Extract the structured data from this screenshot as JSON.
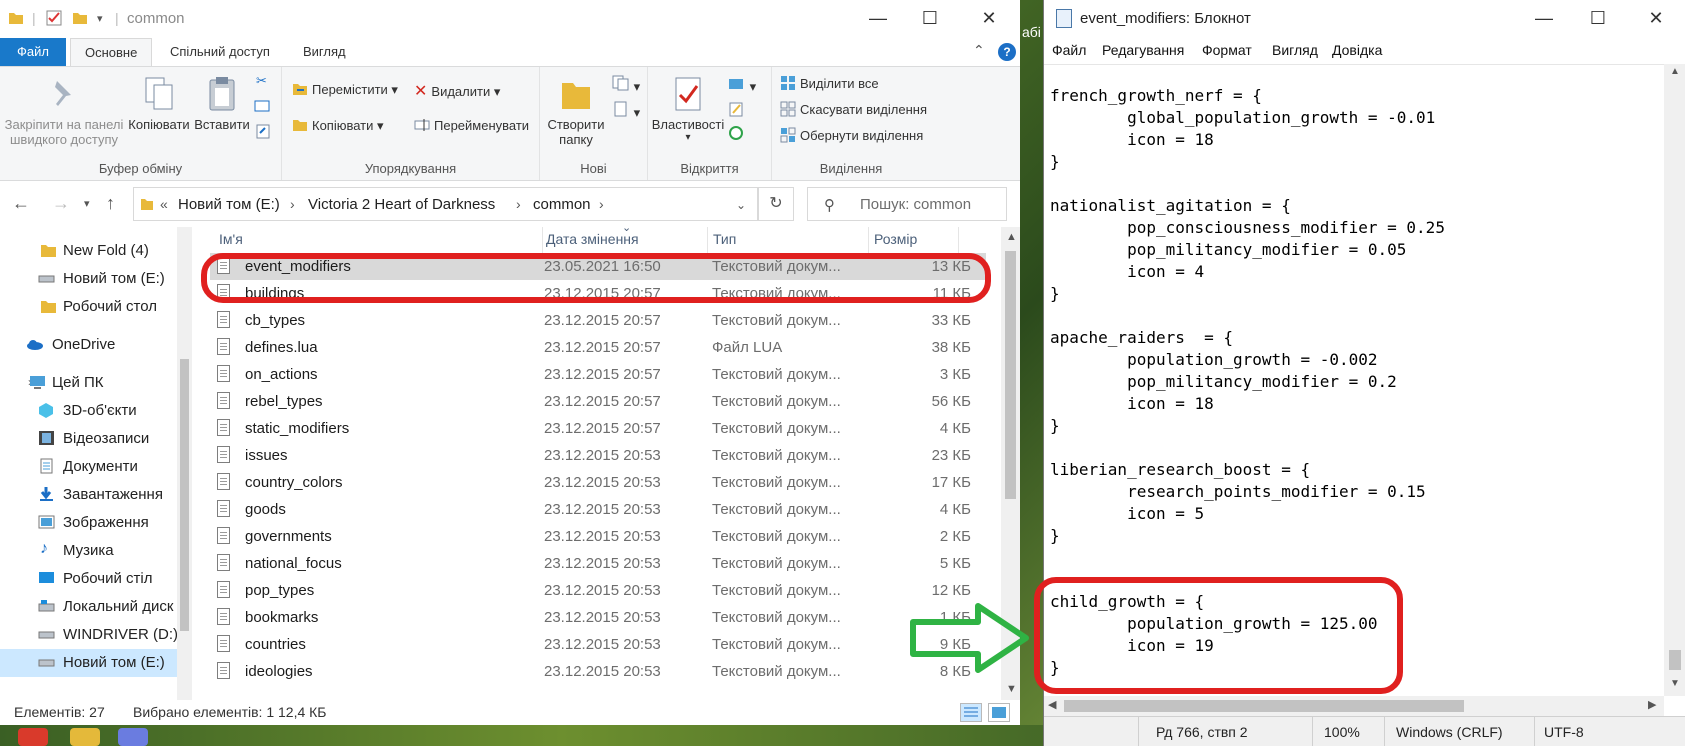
{
  "colors": {
    "accent": "#1979ca",
    "selection": "#d9d9d9",
    "highlight_red": "#e0201f",
    "arrow_green": "#2fb344"
  },
  "explorer": {
    "title": "common",
    "qa_icons": [
      "folder-icon",
      "checkbox-icon",
      "folder-icon",
      "dropdown-icon"
    ],
    "window_buttons": {
      "minimize": "—",
      "maximize": "☐",
      "close": "✕"
    },
    "tabs": {
      "file": "Файл",
      "home": "Основне",
      "share": "Спільний доступ",
      "view": "Вигляд"
    },
    "help": "?",
    "ribbon": {
      "clipboard": {
        "label": "Буфер обміну",
        "pin": "Закріпити на панелі швидкого доступу",
        "pin_line1": "Закріпити на панелі",
        "pin_line2": "швидкого доступу",
        "copy": "Копіювати",
        "paste": "Вставити"
      },
      "organize": {
        "label": "Упорядкування",
        "move": "Перемістити",
        "copy_to": "Копіювати",
        "delete": "Видалити",
        "rename": "Перейменувати"
      },
      "new": {
        "label": "Нові",
        "create_line1": "Створити",
        "create_line2": "папку"
      },
      "open": {
        "label": "Відкриття",
        "properties": "Властивості"
      },
      "select": {
        "label": "Виділення",
        "select_all": "Виділити все",
        "select_none": "Скасувати виділення",
        "invert": "Обернути виділення"
      }
    },
    "address": {
      "chevron": "«",
      "crumbs": [
        "Новий том (E:)",
        "Victoria 2 Heart of Darkness",
        "common"
      ],
      "search_placeholder": "Пошук: common"
    },
    "nav": {
      "items": [
        {
          "label": "New Fold (4)",
          "icon": "folder-icon"
        },
        {
          "label": "Новий том (E:)",
          "icon": "drive-icon"
        },
        {
          "label": "Робочий стол",
          "icon": "folder-icon"
        },
        {
          "label": "OneDrive",
          "icon": "cloud-icon"
        },
        {
          "label": "Цей ПК",
          "icon": "pc-icon"
        },
        {
          "label": "3D-об'єкти",
          "icon": "cube-icon"
        },
        {
          "label": "Відеозаписи",
          "icon": "film-icon"
        },
        {
          "label": "Документи",
          "icon": "document-icon"
        },
        {
          "label": "Завантаження",
          "icon": "download-icon"
        },
        {
          "label": "Зображення",
          "icon": "picture-icon"
        },
        {
          "label": "Музика",
          "icon": "music-icon"
        },
        {
          "label": "Робочий стіл",
          "icon": "desktop-icon"
        },
        {
          "label": "Локальний диск",
          "icon": "disk-icon"
        },
        {
          "label": "WINDRIVER (D:)",
          "icon": "drive-icon"
        },
        {
          "label": "Новий том (E:)",
          "icon": "drive-icon"
        }
      ]
    },
    "columns": {
      "name": "Ім'я",
      "date": "Дата змінення",
      "type": "Тип",
      "size": "Розмір"
    },
    "files": [
      {
        "name": "event_modifiers",
        "date": "23.05.2021 16:50",
        "type": "Текстовий докум...",
        "size": "13 КБ"
      },
      {
        "name": "buildings",
        "date": "23.12.2015 20:57",
        "type": "Текстовий докум...",
        "size": "11 КБ"
      },
      {
        "name": "cb_types",
        "date": "23.12.2015 20:57",
        "type": "Текстовий докум...",
        "size": "33 КБ"
      },
      {
        "name": "defines.lua",
        "date": "23.12.2015 20:57",
        "type": "Файл LUA",
        "size": "38 КБ"
      },
      {
        "name": "on_actions",
        "date": "23.12.2015 20:57",
        "type": "Текстовий докум...",
        "size": "3 КБ"
      },
      {
        "name": "rebel_types",
        "date": "23.12.2015 20:57",
        "type": "Текстовий докум...",
        "size": "56 КБ"
      },
      {
        "name": "static_modifiers",
        "date": "23.12.2015 20:57",
        "type": "Текстовий докум...",
        "size": "4 КБ"
      },
      {
        "name": "issues",
        "date": "23.12.2015 20:53",
        "type": "Текстовий докум...",
        "size": "23 КБ"
      },
      {
        "name": "country_colors",
        "date": "23.12.2015 20:53",
        "type": "Текстовий докум...",
        "size": "17 КБ"
      },
      {
        "name": "goods",
        "date": "23.12.2015 20:53",
        "type": "Текстовий докум...",
        "size": "4 КБ"
      },
      {
        "name": "governments",
        "date": "23.12.2015 20:53",
        "type": "Текстовий докум...",
        "size": "2 КБ"
      },
      {
        "name": "national_focus",
        "date": "23.12.2015 20:53",
        "type": "Текстовий докум...",
        "size": "5 КБ"
      },
      {
        "name": "pop_types",
        "date": "23.12.2015 20:53",
        "type": "Текстовий докум...",
        "size": "12 КБ"
      },
      {
        "name": "bookmarks",
        "date": "23.12.2015 20:53",
        "type": "Текстовий докум...",
        "size": "1 КБ"
      },
      {
        "name": "countries",
        "date": "23.12.2015 20:53",
        "type": "Текстовий докум...",
        "size": "9 КБ"
      },
      {
        "name": "ideologies",
        "date": "23.12.2015 20:53",
        "type": "Текстовий докум...",
        "size": "8 КБ"
      }
    ],
    "status": {
      "count": "Елементів: 27",
      "selected": "Вибрано елементів: 1  12,4 КБ"
    }
  },
  "notepad": {
    "title": "event_modifiers: Блокнот",
    "menu": [
      "Файл",
      "Редагування",
      "Формат",
      "Вигляд",
      "Довідка"
    ],
    "content": "french_growth_nerf = {\n        global_population_growth = -0.01\n        icon = 18\n}\n\nnationalist_agitation = {\n        pop_consciousness_modifier = 0.25\n        pop_militancy_modifier = 0.05\n        icon = 4\n}\n\napache_raiders  = {\n        population_growth = -0.002\n        pop_militancy_modifier = 0.2\n        icon = 18\n}\n\nliberian_research_boost = {\n        research_points_modifier = 0.15\n        icon = 5\n}\n\n\nchild_growth = {\n        population_growth = 125.00\n        icon = 19\n}",
    "status": {
      "position": "Рд 766, ствп 2",
      "zoom": "100%",
      "eol": "Windows (CRLF)",
      "encoding": "UTF-8"
    }
  },
  "desktop_text": "абі"
}
